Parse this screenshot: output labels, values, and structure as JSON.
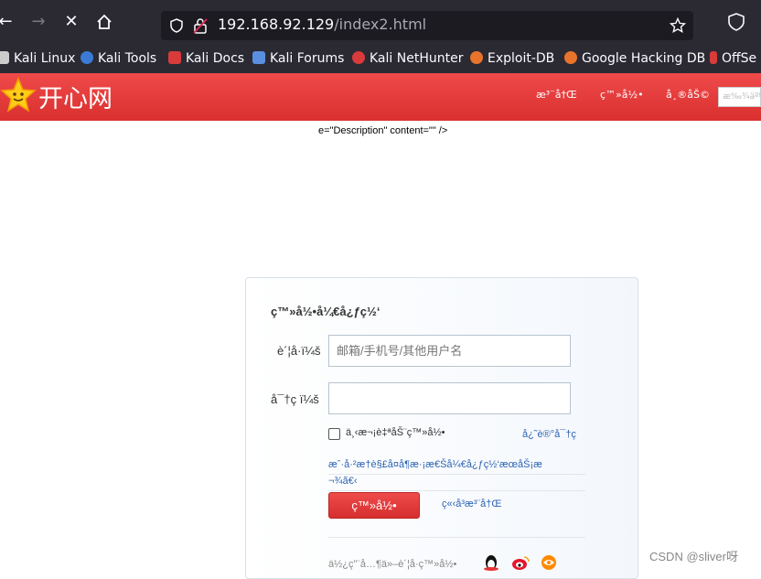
{
  "browser": {
    "url_host": "192.168.92.129",
    "url_path": "/index2.html"
  },
  "bookmarks": [
    {
      "label": "Kali Linux",
      "icon": "kali-dragon-icon",
      "color": "#cccccc"
    },
    {
      "label": "Kali Tools",
      "icon": "kali-tools-icon",
      "color": "#3a7bd5"
    },
    {
      "label": "Kali Docs",
      "icon": "kali-docs-icon",
      "color": "#d93b3b"
    },
    {
      "label": "Kali Forums",
      "icon": "kali-forums-icon",
      "color": "#5a8fe0"
    },
    {
      "label": "Kali NetHunter",
      "icon": "nethunter-icon",
      "color": "#d93b3b"
    },
    {
      "label": "Exploit-DB",
      "icon": "exploit-db-icon",
      "color": "#e8742c"
    },
    {
      "label": "Google Hacking DB",
      "icon": "ghdb-icon",
      "color": "#e8742c"
    },
    {
      "label": "OffSe",
      "icon": "offsec-icon",
      "color": "#d93b3b"
    }
  ],
  "site": {
    "logo_text": "开心网",
    "header_links": [
      "æ³¨å†Œ",
      "ç™»å½•",
      "å¸®åŠ©"
    ],
    "search_placeholder": "æ‰¾äººœå",
    "leaked_markup": "e=\"Description\" content=\"\" />",
    "brand_color": "#e23a3a"
  },
  "login": {
    "title": "ç™»å½•å¼€å¿ƒç½‘",
    "account_label": "è´¦å·ï¼š",
    "account_placeholder": "邮箱/手机号/其他用户名",
    "password_label": "å¯†ç ï¼š",
    "remember_label": "ä¸‹æ¬¡è‡ªåŠ¨ç™»å½•",
    "forgot_link": "å¿˜è®°å¯†ç ",
    "notice_line1": "æˆ·å·²æ†è§£å¤å¶æ·¡æ€Šå¼€å¿ƒç½‘æœåŠ¡æ",
    "notice_line2": "¬¾ã€‹",
    "login_button": "ç™»å½•",
    "register_link": "ç«‹å³æ³¨å†Œ",
    "other_login": "ä½¿ç”¨å…¶ä»–è´¦å·ç™»å½•",
    "social_icons": [
      "qq-penguin-icon",
      "weibo-icon",
      "tianyi-icon"
    ]
  },
  "watermark": "CSDN @sliver呀"
}
